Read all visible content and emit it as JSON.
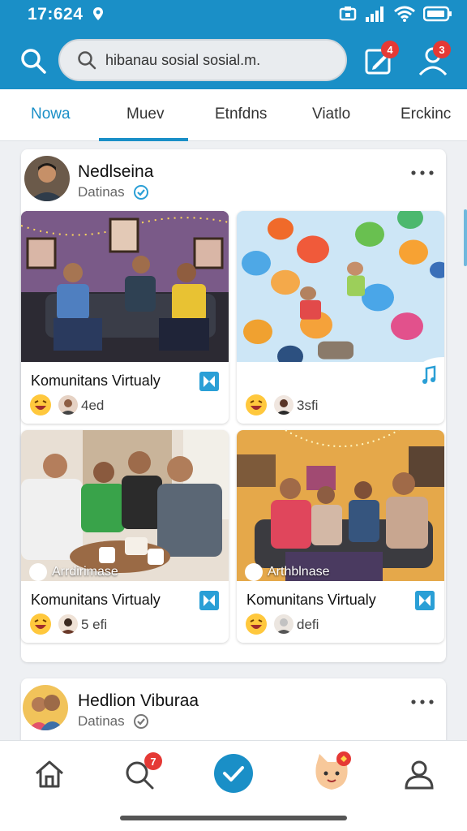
{
  "status_bar": {
    "time": "17:624"
  },
  "search": {
    "value": "hibanau sosial sosial.m."
  },
  "header": {
    "inbox_badge": "4",
    "profile_badge": "3"
  },
  "tabs": [
    {
      "label": "Nowa",
      "active": true
    },
    {
      "label": "Muev"
    },
    {
      "label": "Etnfdns"
    },
    {
      "label": "Viatlo"
    },
    {
      "label": "Erckinc"
    }
  ],
  "post1": {
    "author": "Nedlseina",
    "subtitle": "Datinas",
    "tiles": [
      {
        "title": "Komunitans Virtualy",
        "reaction_count": "4ed",
        "caption": ""
      },
      {
        "title": "",
        "reaction_count": "3sfi",
        "caption": ""
      },
      {
        "title": "Komunitans Virtualy",
        "reaction_count": "5 efi",
        "caption": "Arrdirimase"
      },
      {
        "title": "Komunitans Virtualy",
        "reaction_count": "defi",
        "caption": "Arthblnase"
      }
    ]
  },
  "post2": {
    "author": "Hedlion Viburaa",
    "subtitle": "Datinas"
  },
  "bottom_nav": {
    "search_badge": "7",
    "items": [
      "home-icon",
      "search-icon",
      "check-icon",
      "cat-avatar-icon",
      "profile-icon"
    ]
  },
  "colors": {
    "brand": "#1a8fc7",
    "badge": "#e53935"
  }
}
